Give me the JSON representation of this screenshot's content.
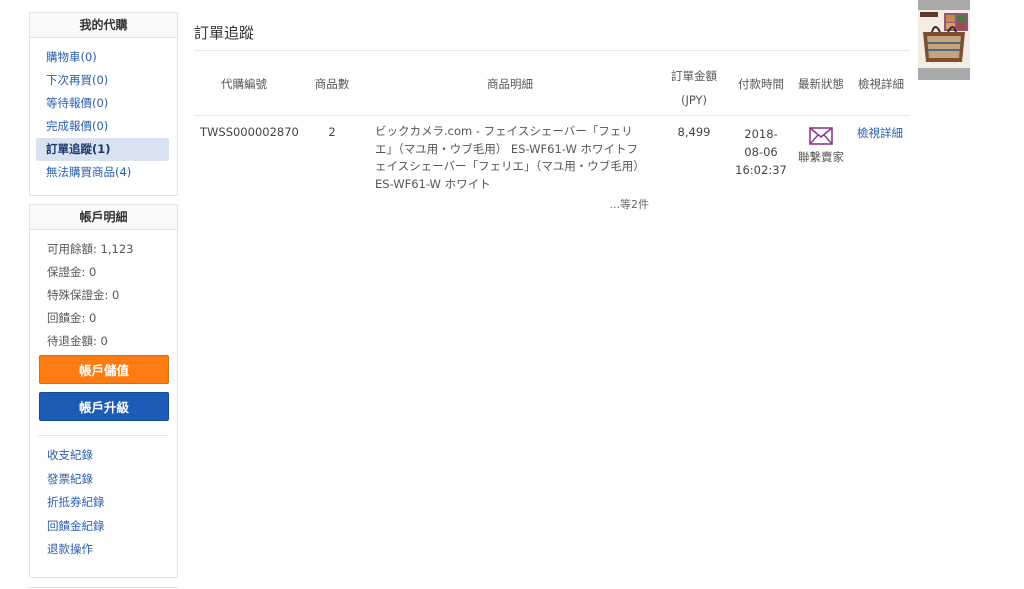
{
  "sidebar": {
    "purchase_title": "我的代購",
    "purchase_items": [
      {
        "label": "購物車(0)"
      },
      {
        "label": "下次再買(0)"
      },
      {
        "label": "等待報價(0)"
      },
      {
        "label": "完成報價(0)"
      },
      {
        "label": "訂單追蹤(1)",
        "active": true
      },
      {
        "label": "無法購買商品(4)"
      }
    ],
    "account_title": "帳戶明細",
    "account_rows": [
      {
        "label": "可用餘額: 1,123"
      },
      {
        "label": "保證金: 0"
      },
      {
        "label": "特殊保證金: 0"
      },
      {
        "label": "回饋金: 0"
      },
      {
        "label": "待退金額: 0"
      }
    ],
    "topup_label": "帳戶儲值",
    "upgrade_label": "帳戶升級",
    "records": [
      {
        "label": "收支紀錄"
      },
      {
        "label": "發票紀錄"
      },
      {
        "label": "折抵券紀錄"
      },
      {
        "label": "回饋金紀錄"
      },
      {
        "label": "退款操作"
      }
    ]
  },
  "main": {
    "title": "訂單追蹤",
    "headers": {
      "order_id": "代購編號",
      "qty": "商品數",
      "detail": "商品明細",
      "amount_line1": "訂單金額",
      "amount_line2": "(JPY)",
      "pay_time": "付款時間",
      "status": "最新狀態",
      "view": "檢視詳細"
    },
    "rows": [
      {
        "order_id": "TWSS000002870",
        "qty": "2",
        "detail": "ビックカメラ.com - フェイスシェーバー「フェリエ」（マユ用・ウブ毛用） ES-WF61-W ホワイトフェイスシェーバー「フェリエ」（マユ用・ウブ毛用） ES-WF61-W ホワイト",
        "more": "...等2件",
        "amount": "8,499",
        "time_line1": "2018-",
        "time_line2": "08-06",
        "time_line3": "16:02:37",
        "status_label": "聯繫賣家",
        "status_icon": "envelope-icon",
        "view_label": "檢視詳細"
      }
    ]
  },
  "colors": {
    "link": "#2a5db0",
    "topup": "#ff7c12",
    "upgrade": "#1c5bb6",
    "active_bg": "#d9e2f1",
    "envelope": "#8a3a8a"
  }
}
